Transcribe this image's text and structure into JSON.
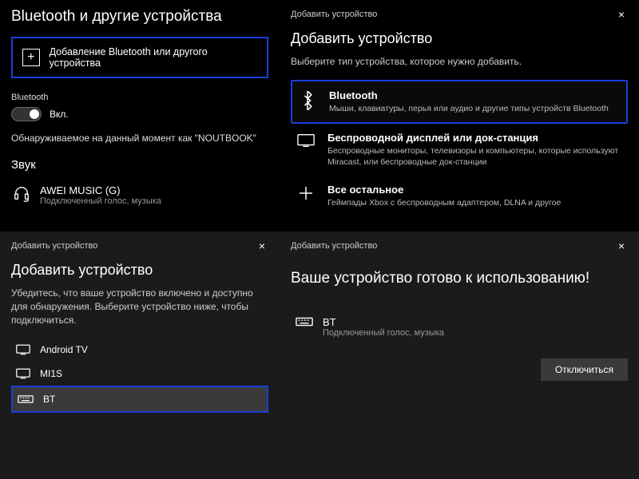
{
  "q1": {
    "title": "Bluetooth и другие устройства",
    "addDevice": "Добавление Bluetooth или другого устройства",
    "btLabel": "Bluetooth",
    "toggleOn": "Вкл.",
    "discoverable": "Обнаруживаемое на данный момент как \"NOUTBOOK\"",
    "audioHdr": "Звук",
    "audioDev": {
      "name": "AWEI MUSIC (G)",
      "desc": "Подключенный голос, музыка"
    }
  },
  "q2": {
    "winTitle": "Добавить устройство",
    "title": "Добавить устройство",
    "sub": "Выберите тип устройства, которое нужно добавить.",
    "opts": [
      {
        "name": "Bluetooth",
        "desc": "Мыши, клавиатуры, перья или аудио и другие типы устройств Bluetooth"
      },
      {
        "name": "Беспроводной дисплей или док-станция",
        "desc": "Беспроводные мониторы, телевизоры и компьютеры, которые используют Miracast, или беспроводные док-станции"
      },
      {
        "name": "Все остальное",
        "desc": "Геймпады Xbox с беспроводным адаптером, DLNA и другое"
      }
    ]
  },
  "q3": {
    "winTitle": "Добавить устройство",
    "title": "Добавить устройство",
    "sub": "Убедитесь, что ваше устройство включено и доступно для обнаружения. Выберите устройство ниже, чтобы подключиться.",
    "items": [
      "Android TV",
      "MI1S",
      "BT"
    ]
  },
  "q4": {
    "winTitle": "Добавить устройство",
    "ready": "Ваше устройство готово к использованию!",
    "dev": {
      "name": "BT",
      "desc": "Подключенный голос, музыка"
    },
    "disconnect": "Отключиться"
  }
}
